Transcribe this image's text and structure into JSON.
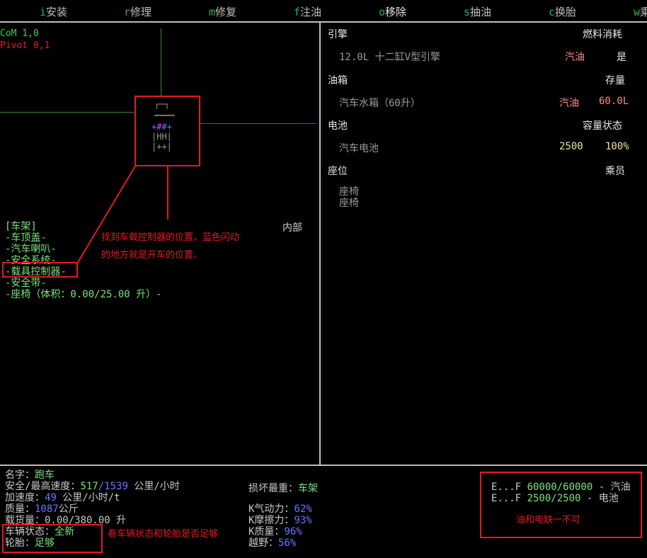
{
  "menu": [
    {
      "key": "i",
      "label": "安装"
    },
    {
      "key": "r",
      "label": "修理"
    },
    {
      "key": "m",
      "label": "修复"
    },
    {
      "key": "f",
      "label": "注油"
    },
    {
      "key": "o",
      "label": "移除"
    },
    {
      "key": "s",
      "label": "抽油"
    },
    {
      "key": "c",
      "label": "换胎"
    },
    {
      "key": "w",
      "label": "乘"
    }
  ],
  "map": {
    "com_label": "CoM   1,0",
    "pivot_label": "Pivot 0,1",
    "vehicle_rows": [
      "┌─┐",
      "‗‗‗‗",
      "+##+",
      "|HH|",
      "|++|"
    ]
  },
  "parts": {
    "items": [
      "[车架]",
      "-车顶盖-",
      "-汽车喇叭-",
      "-安全系统-",
      "-载具控制器-",
      "-安全带-",
      "-座椅（体积：0.00/25.00 升）-"
    ],
    "inner_label": "内部"
  },
  "notes": {
    "controller": "找到车载控制器的位置，蓝色闪动\n的地方就是开车的位置。",
    "status": "看车辆状态和轮胎是否足够",
    "fuel": "油和电缺一不可"
  },
  "right": {
    "engine_header": "引擎",
    "engine_col": "燃料消耗",
    "engine_item": "12.0L 十二缸V型引擎",
    "engine_fuel": "汽油",
    "engine_val": "是",
    "tank_header": "油箱",
    "tank_col": "存量",
    "tank_item": "汽车水箱（60升）",
    "tank_fuel": "汽油",
    "tank_val": "60.0L",
    "battery_header": "电池",
    "battery_col": "容量状态",
    "battery_item": "汽车电池",
    "battery_cap": "2500",
    "battery_pct": "100%",
    "seat_header": "座位",
    "seat_col": "乘员",
    "seat_items": [
      "座椅",
      "座椅"
    ]
  },
  "stats": {
    "name_label": "名字：",
    "name_val": "跑车",
    "speed_label": "安全/最高速度：",
    "speed_safe": "517",
    "speed_max": "/1539",
    "speed_unit": " 公里/小时",
    "accel_label": "加速度：",
    "accel_val": "49",
    "accel_unit": " 公里/小时/t",
    "mass_label": "质量：",
    "mass_val": "1087",
    "mass_unit": "公斤",
    "cargo_label": "载货量：",
    "cargo_val": "0.00/380.00 升",
    "cond_label": "车辆状态：",
    "cond_val": "全新",
    "tire_label": "轮胎：",
    "tire_val": "足够",
    "damage_label": "损坏最重：",
    "damage_val": "车架",
    "k_aero_label": "K气动力：",
    "k_aero_val": "62%",
    "k_fric_label": "K摩擦力：",
    "k_fric_val": "93%",
    "k_mass_label": "K质量：",
    "k_mass_val": "96%",
    "offroad_label": "越野：",
    "offroad_val": "56%"
  },
  "fuel_box": {
    "line1_prefix": "E...F ",
    "line1_val": "60000/60000",
    "line1_suffix": " - 汽油",
    "line2_prefix": "E...F ",
    "line2_val": "2500/2500",
    "line2_suffix": " - 电池"
  }
}
